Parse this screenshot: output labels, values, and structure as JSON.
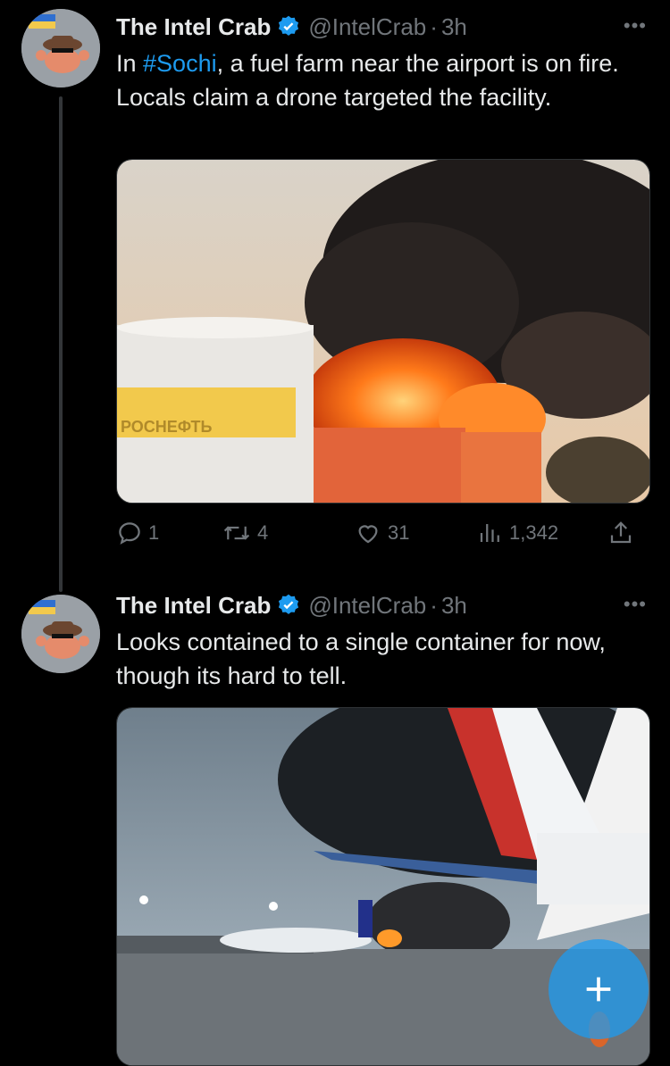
{
  "tweets": [
    {
      "name": "The Intel Crab",
      "handle": "@IntelCrab",
      "sep": "·",
      "time": "3h",
      "text_before": "In ",
      "hashtag": "#Sochi",
      "text_after": ", a fuel farm near the airport is on fire. Locals claim a drone targeted the facility.",
      "media_alt": "Burning fuel tank at Rosneft facility",
      "tank_sign": "РОСНЕФТЬ",
      "actions": {
        "replies": "1",
        "retweets": "4",
        "likes": "31",
        "views": "1,342"
      }
    },
    {
      "name": "The Intel Crab",
      "handle": "@IntelCrab",
      "sep": "·",
      "time": "3h",
      "text": "Looks contained to a single container for now, though its hard to tell.",
      "media_alt": "Airport apron with planes and smoke in the distance"
    }
  ],
  "colors": {
    "accent": "#1d9bf0",
    "muted": "#71767b",
    "background": "#000000"
  }
}
